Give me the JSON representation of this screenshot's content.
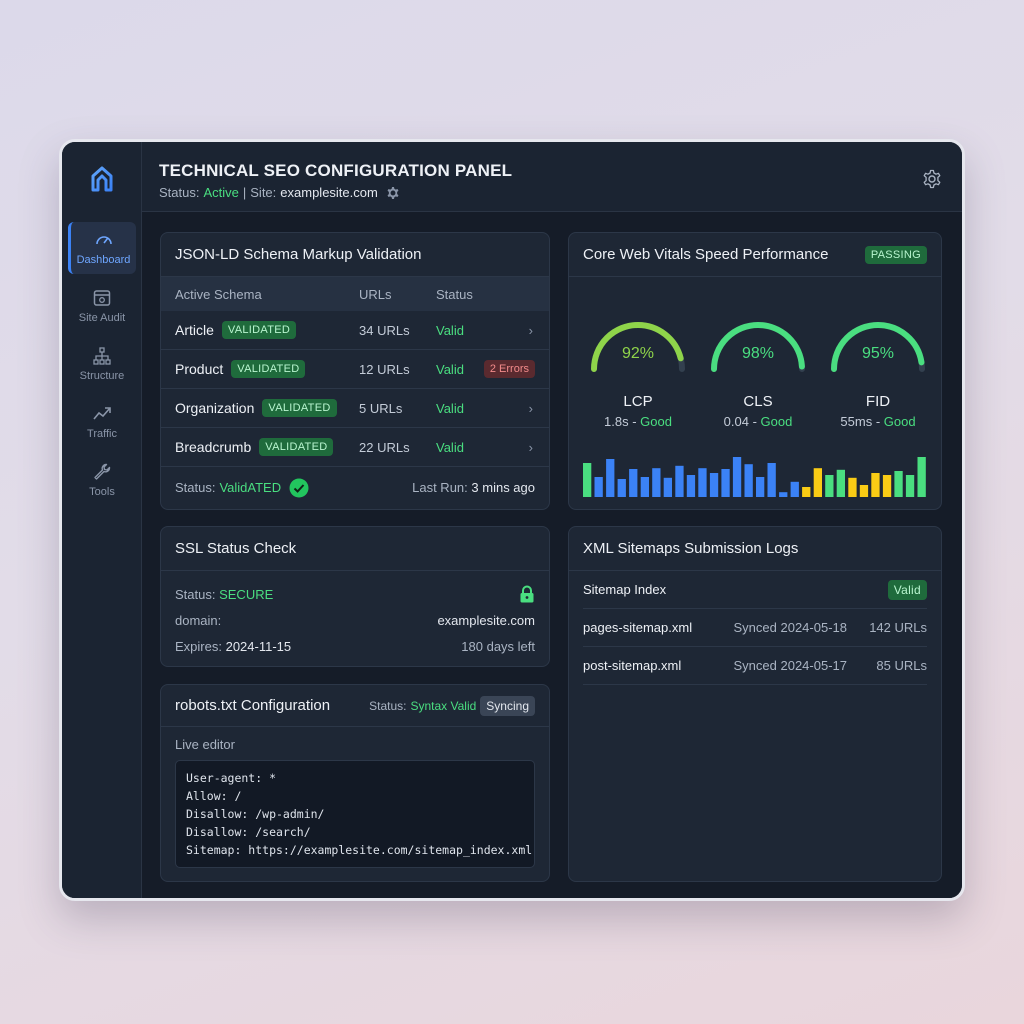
{
  "header": {
    "title": "TECHNICAL SEO CONFIGURATION PANEL",
    "status_label": "Status:",
    "status_value": "Active",
    "separator": "|",
    "site_label": "Site:",
    "site_value": "examplesite.com"
  },
  "sidebar": {
    "items": [
      {
        "label": "Dashboard",
        "icon": "speedometer-icon"
      },
      {
        "label": "Site Audit",
        "icon": "browser-window-icon"
      },
      {
        "label": "Structure",
        "icon": "sitemap-tree-icon"
      },
      {
        "label": "Traffic",
        "icon": "trend-up-icon"
      },
      {
        "label": "Tools",
        "icon": "wrench-icon"
      }
    ]
  },
  "schema": {
    "title": "JSON-LD Schema Markup Validation",
    "columns": [
      "Active Schema",
      "URLs",
      "Status"
    ],
    "rows": [
      {
        "name": "Article",
        "badge": "VALIDATED",
        "urls": "34 URLs",
        "status": "Valid",
        "extra": ""
      },
      {
        "name": "Product",
        "badge": "VALIDATED",
        "urls": "12 URLs",
        "status": "Valid",
        "extra": "2 Errors"
      },
      {
        "name": "Organization",
        "badge": "VALIDATED",
        "urls": "5 URLs",
        "status": "Valid",
        "extra": ""
      },
      {
        "name": "Breadcrumb",
        "badge": "VALIDATED",
        "urls": "22 URLs",
        "status": "Valid",
        "extra": ""
      }
    ],
    "footer_status_label": "Status:",
    "footer_status_value": "ValidATED",
    "last_run_label": "Last Run:",
    "last_run_value": "3 mins ago"
  },
  "vitals": {
    "title": "Core Web Vitals Speed Performance",
    "badge": "PASSING",
    "gauges": [
      {
        "pct": "92%",
        "fraction": 0.92,
        "name": "LCP",
        "value": "1.8s",
        "grade": "Good",
        "color": "#8fd44a"
      },
      {
        "pct": "98%",
        "fraction": 0.98,
        "name": "CLS",
        "value": "0.04",
        "grade": "Good",
        "color": "#4ade80"
      },
      {
        "pct": "95%",
        "fraction": 0.95,
        "name": "FID",
        "value": "55ms",
        "grade": "Good",
        "color": "#4ade80"
      }
    ],
    "bars": [
      {
        "v": 0.85,
        "c": "#4ade80"
      },
      {
        "v": 0.5,
        "c": "#3b82f6"
      },
      {
        "v": 0.95,
        "c": "#3b82f6"
      },
      {
        "v": 0.45,
        "c": "#3b82f6"
      },
      {
        "v": 0.7,
        "c": "#3b82f6"
      },
      {
        "v": 0.5,
        "c": "#3b82f6"
      },
      {
        "v": 0.72,
        "c": "#3b82f6"
      },
      {
        "v": 0.48,
        "c": "#3b82f6"
      },
      {
        "v": 0.78,
        "c": "#3b82f6"
      },
      {
        "v": 0.55,
        "c": "#3b82f6"
      },
      {
        "v": 0.72,
        "c": "#3b82f6"
      },
      {
        "v": 0.6,
        "c": "#3b82f6"
      },
      {
        "v": 0.7,
        "c": "#3b82f6"
      },
      {
        "v": 1.0,
        "c": "#3b82f6"
      },
      {
        "v": 0.82,
        "c": "#3b82f6"
      },
      {
        "v": 0.5,
        "c": "#3b82f6"
      },
      {
        "v": 0.85,
        "c": "#3b82f6"
      },
      {
        "v": 0.12,
        "c": "#3b82f6"
      },
      {
        "v": 0.38,
        "c": "#3b82f6"
      },
      {
        "v": 0.25,
        "c": "#facc15"
      },
      {
        "v": 0.72,
        "c": "#facc15"
      },
      {
        "v": 0.55,
        "c": "#4ade80"
      },
      {
        "v": 0.68,
        "c": "#4ade80"
      },
      {
        "v": 0.48,
        "c": "#facc15"
      },
      {
        "v": 0.3,
        "c": "#facc15"
      },
      {
        "v": 0.6,
        "c": "#facc15"
      },
      {
        "v": 0.55,
        "c": "#facc15"
      },
      {
        "v": 0.65,
        "c": "#4ade80"
      },
      {
        "v": 0.55,
        "c": "#4ade80"
      },
      {
        "v": 1.0,
        "c": "#4ade80"
      }
    ]
  },
  "ssl": {
    "title": "SSL Status Check",
    "status_label": "Status:",
    "status_value": "SECURE",
    "domain_label": "domain:",
    "domain_value": "examplesite.com",
    "expires_label": "Expires:",
    "expires_value": "2024-11-15",
    "days_left": "180 days left"
  },
  "robots": {
    "title": "robots.txt Configuration",
    "status_label": "Status:",
    "status_value": "Syntax Valid",
    "sync_badge": "Syncing",
    "editor_label": "Live editor",
    "code": "User-agent: *\nAllow: /\nDisallow: /wp-admin/\nDisallow: /search/\nSitemap: https://examplesite.com/sitemap_index.xml"
  },
  "sitemaps": {
    "title": "XML Sitemaps Submission Logs",
    "index_label": "Sitemap Index",
    "index_badge": "Valid",
    "rows": [
      {
        "name": "pages-sitemap.xml",
        "synced": "Synced 2024-05-18",
        "urls": "142 URLs"
      },
      {
        "name": "post-sitemap.xml",
        "synced": "Synced 2024-05-17",
        "urls": "85 URLs"
      }
    ]
  },
  "colors": {
    "accent": "#3b82f6",
    "success": "#4ade80",
    "warning": "#facc15",
    "error": "#f28b8b"
  }
}
